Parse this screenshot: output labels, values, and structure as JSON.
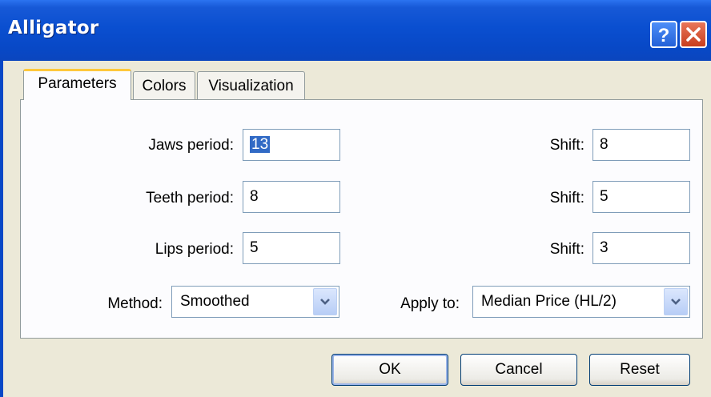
{
  "window": {
    "title": "Alligator"
  },
  "title_buttons": {
    "help": "help-icon",
    "close": "close-icon"
  },
  "tabs": [
    {
      "label": "Parameters",
      "active": true
    },
    {
      "label": "Colors",
      "active": false
    },
    {
      "label": "Visualization",
      "active": false
    }
  ],
  "params": {
    "jaws_label": "Jaws period:",
    "jaws_value": "13",
    "teeth_label": "Teeth period:",
    "teeth_value": "8",
    "lips_label": "Lips period:",
    "lips_value": "5",
    "shift_label": "Shift:",
    "jaws_shift": "8",
    "teeth_shift": "5",
    "lips_shift": "3",
    "method_label": "Method:",
    "method_value": "Smoothed",
    "apply_label": "Apply to:",
    "apply_value": "Median Price (HL/2)"
  },
  "buttons": {
    "ok": "OK",
    "cancel": "Cancel",
    "reset": "Reset"
  },
  "colors": {
    "titlebar": "#0a4fd0",
    "face": "#ece9d8",
    "tab_accent": "#ffc83c",
    "selection": "#316ac5"
  }
}
